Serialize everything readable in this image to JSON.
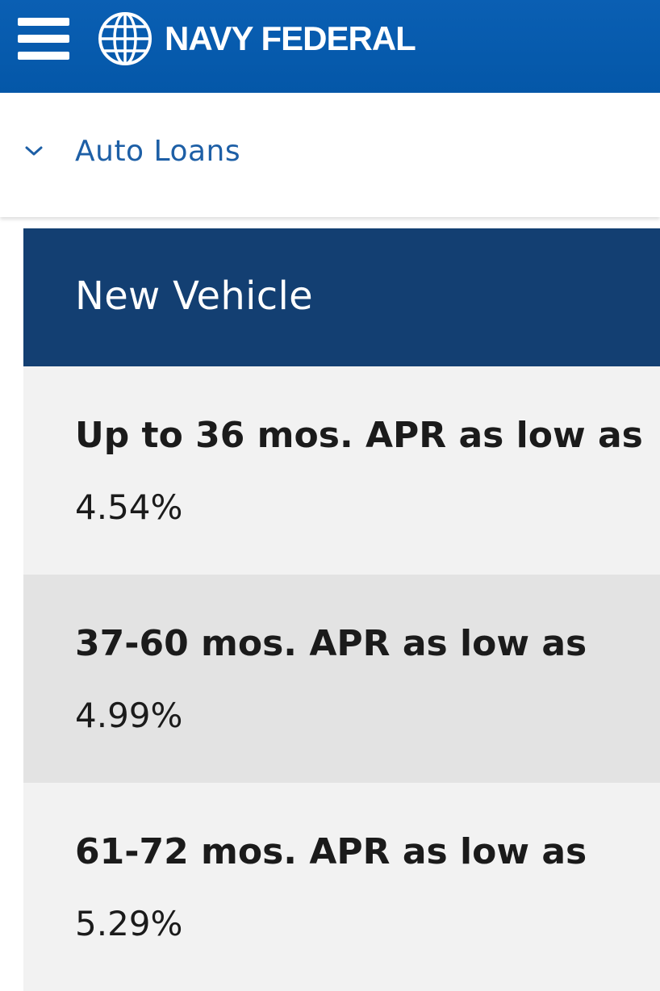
{
  "header": {
    "brand_name": "NAVY FEDERAL",
    "menu_icon": "hamburger-menu-icon",
    "logo_icon": "globe-icon",
    "background_color": "#0457a8"
  },
  "subnav": {
    "label": "Auto Loans",
    "icon": "chevron-down-icon",
    "text_color": "#1d5fa6"
  },
  "rates_card": {
    "title": "New Vehicle",
    "header_color": "#133f72",
    "rows": [
      {
        "term": "Up to 36 mos. APR as low as",
        "rate": "4.54%"
      },
      {
        "term": "37-60 mos. APR as low as",
        "rate": "4.99%"
      },
      {
        "term": "61-72 mos. APR as low as",
        "rate": "5.29%"
      }
    ]
  }
}
